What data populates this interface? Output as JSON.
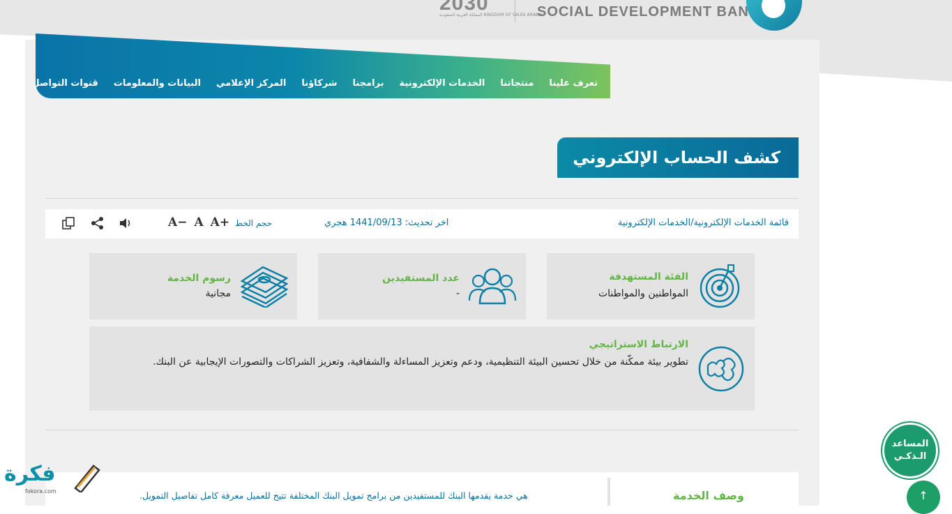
{
  "header": {
    "bank_name_en": "SOCIAL DEVELOPMENT BANK",
    "vision_logo": "2030",
    "vision_sub": "المملكة العربية السعودية KINGDOM OF SAUDI ARABIA"
  },
  "nav": {
    "items": [
      "تعرف علينا",
      "منتجاتنا",
      "الخدمات الإلكترونية",
      "برامجنا",
      "شركاؤنا",
      "المركز الإعلامي",
      "البيانات والمعلومات",
      "قنوات التواصل"
    ]
  },
  "page": {
    "title": "كشف الحساب الإلكتروني"
  },
  "toolbar": {
    "breadcrumb_first": "قائمة الخدمات الإلكترونية",
    "breadcrumb_sep": "/",
    "breadcrumb_second": "الخدمات الإلكترونية",
    "last_update": "اخر تحديث: 1441/09/13 هجري",
    "font_size_label": "حجم الخط",
    "font_increase": "A+",
    "font_normal": "A",
    "font_decrease": "A−",
    "icons": [
      "speaker-icon",
      "share-icon",
      "copy-icon"
    ]
  },
  "cards": {
    "target": {
      "title": "الفئة المستهدفة",
      "value": "المواطنين والمواطنات"
    },
    "beneficiaries": {
      "title": "عدد المستفيدين",
      "value": "-"
    },
    "fees": {
      "title": "رسوم الخدمة",
      "value": "مجانية"
    },
    "strategic": {
      "title": "الارتباط الاستراتيجي",
      "text": "تطوير بيئة ممكّنة من خلال تحسين البيئة التنظيمية، ودعم وتعزيز المساءلة والشفافية، وتعزيز الشراكات والتصورات الإيجابية عن البنك."
    }
  },
  "description": {
    "title": "وصف الخدمة",
    "text": "هي خدمة يقدمها البنك للمستفيدين من برامج تمويل البنك المختلفة تتيح للعميل معرفة كامل تفاصيل التمويل."
  },
  "assistant": {
    "line1": "المساعد",
    "line2": "الـذكـي"
  },
  "to_top": "↑",
  "watermark": {
    "text": "فكرة",
    "sub": "fokora.com"
  },
  "colors": {
    "primary": "#0a74a8",
    "accent_green": "#64b545",
    "teal": "#0b8aa6"
  }
}
